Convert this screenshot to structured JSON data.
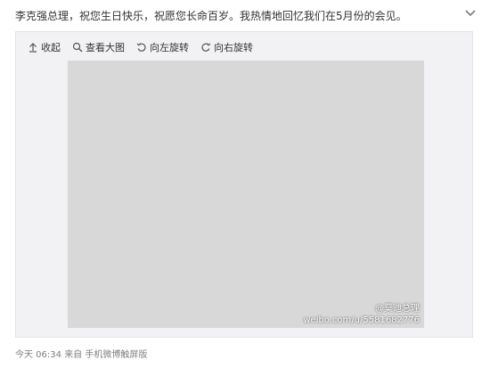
{
  "post": {
    "text": "李克强总理，祝您生日快乐，祝愿您长命百岁。我热情地回忆我们在5月份的会见。"
  },
  "toolbar": {
    "items": [
      {
        "label": "收起",
        "icon": "collapse-up-icon"
      },
      {
        "label": "查看大图",
        "icon": "magnifier-icon"
      },
      {
        "label": "向左旋转",
        "icon": "rotate-left-icon"
      },
      {
        "label": "向右旋转",
        "icon": "rotate-right-icon"
      }
    ]
  },
  "photo": {
    "watermark_account": "@莫迪总理",
    "watermark_url": "weibo.com/u/5581682776"
  },
  "footer": {
    "time": "今天 06:34",
    "source_prefix": "来自",
    "source": "手机微博触屏版"
  },
  "colors": {
    "text": "#333333",
    "muted": "#808080",
    "panel_bg": "#f2f2f5"
  }
}
